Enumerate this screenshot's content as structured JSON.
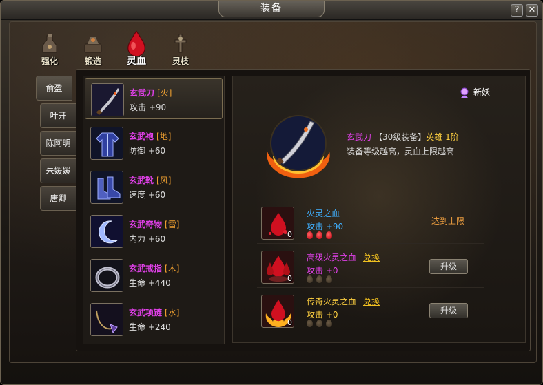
{
  "window": {
    "title": "装备",
    "help_label": "?",
    "close_label": "✕"
  },
  "tabs": [
    {
      "label": "强化",
      "icon": "strengthen-icon",
      "active": false
    },
    {
      "label": "锻造",
      "icon": "forge-icon",
      "active": false
    },
    {
      "label": "灵血",
      "icon": "spirit-blood-icon",
      "active": true
    },
    {
      "label": "灵枝",
      "icon": "spirit-branch-icon",
      "active": false
    }
  ],
  "characters": [
    {
      "label": "俞盈",
      "active": true
    },
    {
      "label": "叶开",
      "active": false
    },
    {
      "label": "陈阿明",
      "active": false
    },
    {
      "label": "朱媛媛",
      "active": false
    },
    {
      "label": "唐卿",
      "active": false
    }
  ],
  "items": [
    {
      "name": "玄武刀",
      "element": "[火]",
      "stat": "攻击 +90",
      "icon": "blade-icon",
      "selected": true
    },
    {
      "name": "玄武袍",
      "element": "[地]",
      "stat": "防御 +60",
      "icon": "robe-icon",
      "selected": false
    },
    {
      "name": "玄武靴",
      "element": "[风]",
      "stat": "速度 +60",
      "icon": "boots-icon",
      "selected": false
    },
    {
      "name": "玄武奇物",
      "element": "[雷]",
      "stat": "内力 +60",
      "icon": "crescent-charm-icon",
      "selected": false
    },
    {
      "name": "玄武戒指",
      "element": "[木]",
      "stat": "生命 +440",
      "icon": "ring-icon",
      "selected": false
    },
    {
      "name": "玄武项链",
      "element": "[水]",
      "stat": "生命 +240",
      "icon": "necklace-icon",
      "selected": false
    }
  ],
  "newbie": {
    "icon": "newbie-icon",
    "label": "新妖"
  },
  "detail": {
    "icon": "fire-blade-icon",
    "name": "玄武刀",
    "level_text": "【30级装备】",
    "grade_text": "英雄 1阶",
    "description": "装备等级越高，灵血上限越高"
  },
  "bloods": [
    {
      "name": "火灵之血",
      "name_color": "#40b0ff",
      "exchange": "",
      "stat": "攻击 +90",
      "stat_color": "#40b0ff",
      "count": "0",
      "drops": [
        true,
        true,
        true
      ],
      "status": "达到上限",
      "button": "",
      "icon": "fire-blood-icon"
    },
    {
      "name": "高级火灵之血",
      "name_color": "#e040e8",
      "exchange": "兑换",
      "stat": "攻击 +0",
      "stat_color": "#e040e8",
      "count": "0",
      "drops": [
        false,
        false,
        false
      ],
      "status": "",
      "button": "升级",
      "icon": "advanced-fire-blood-icon"
    },
    {
      "name": "传奇火灵之血",
      "name_color": "#ffd040",
      "exchange": "兑换",
      "stat": "攻击 +0",
      "stat_color": "#ffd040",
      "count": "0",
      "drops": [
        false,
        false,
        false
      ],
      "status": "",
      "button": "升级",
      "icon": "legendary-fire-blood-icon"
    }
  ]
}
